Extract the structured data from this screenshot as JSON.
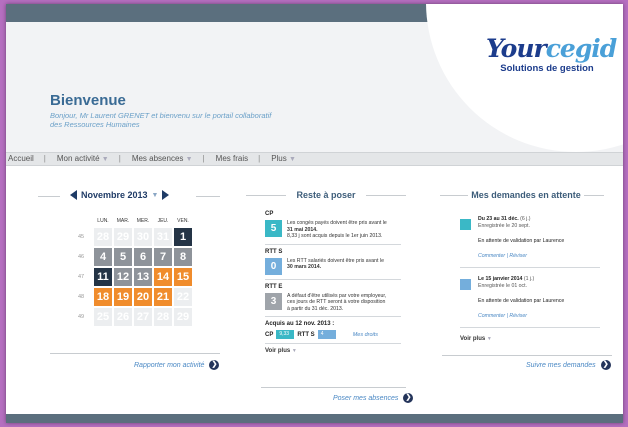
{
  "topbar": {
    "icons": [
      "help-icon",
      "calendar-icon",
      "home-icon",
      "power-icon"
    ]
  },
  "logo": {
    "brand_a": "Your",
    "brand_b": "cegid",
    "tagline": "Solutions de gestion"
  },
  "welcome": {
    "title": "Bienvenue",
    "subtitle_line1": "Bonjour, Mr Laurent GRENET et bienvenu sur le portail collaboratif",
    "subtitle_line2": "des Ressources Humaines"
  },
  "nav": {
    "items": [
      {
        "label": "Accueil"
      },
      {
        "label": "Mon activité"
      },
      {
        "label": "Mes absences"
      },
      {
        "label": "Mes frais"
      },
      {
        "label": "Plus"
      }
    ],
    "separator": "|",
    "caret": "▼"
  },
  "calendar": {
    "month": "Novembre 2013",
    "caret": "▼",
    "day_heads": [
      "LUN.",
      "MAR.",
      "MER.",
      "JEU.",
      "VEN."
    ],
    "weeks": [
      {
        "num": "45",
        "days": [
          {
            "n": "28",
            "s": "light"
          },
          {
            "n": "29",
            "s": "light"
          },
          {
            "n": "30",
            "s": "light"
          },
          {
            "n": "31",
            "s": "light"
          },
          {
            "n": "1",
            "s": "dark"
          }
        ]
      },
      {
        "num": "46",
        "days": [
          {
            "n": "4",
            "s": "grey"
          },
          {
            "n": "5",
            "s": "grey"
          },
          {
            "n": "6",
            "s": "grey"
          },
          {
            "n": "7",
            "s": "grey"
          },
          {
            "n": "8",
            "s": "grey"
          }
        ]
      },
      {
        "num": "47",
        "days": [
          {
            "n": "11",
            "s": "dark"
          },
          {
            "n": "12",
            "s": "grey"
          },
          {
            "n": "13",
            "s": "grey"
          },
          {
            "n": "14",
            "s": "orange"
          },
          {
            "n": "15",
            "s": "orange"
          }
        ]
      },
      {
        "num": "48",
        "days": [
          {
            "n": "18",
            "s": "orange"
          },
          {
            "n": "19",
            "s": "orange"
          },
          {
            "n": "20",
            "s": "orange"
          },
          {
            "n": "21",
            "s": "orange"
          },
          {
            "n": "22",
            "s": "light"
          }
        ]
      },
      {
        "num": "49",
        "days": [
          {
            "n": "25",
            "s": "light"
          },
          {
            "n": "26",
            "s": "light"
          },
          {
            "n": "27",
            "s": "light"
          },
          {
            "n": "28",
            "s": "light"
          },
          {
            "n": "29",
            "s": "light"
          }
        ]
      }
    ],
    "link": "Rapporter mon activité"
  },
  "reste": {
    "title": "Reste à poser",
    "blocks": [
      {
        "title": "CP",
        "value": "5",
        "color": "#3ab8c6",
        "line1": "Les congés payés doivent être pris avant le",
        "line2": "31 mai 2014.",
        "line3": "8,33 j sont acquis depuis le 1er juin 2013."
      },
      {
        "title": "RTT S",
        "value": "0",
        "color": "#74aedc",
        "line1": "Les RTT salariés doivent être pris avant le",
        "line2": "30 mars 2014.",
        "line3": ""
      },
      {
        "title": "RTT E",
        "value": "3",
        "color": "#9fa4aa",
        "line1": "A défaut d'être utilisés par votre employeur,",
        "line2": "ces jours de RTT seront à votre disposition",
        "line3": "à partir du 31 déc. 2013."
      }
    ],
    "acquis_title": "Acquis au 12 nov. 2013 :",
    "acquis_cp_label": "CP",
    "acquis_cp_value": "9,33",
    "acquis_rtt_label": "RTT S",
    "acquis_rtt_value": "4",
    "mes_droits": "Mes droits",
    "voir_plus": "Voir plus",
    "link": "Poser mes absences"
  },
  "demandes": {
    "title": "Mes demandes en attente",
    "items": [
      {
        "period": "Du 23 au 31 déc.",
        "days": "(6 j.)",
        "registered": "Enregistrée le 20 sept.",
        "status": "En attente de validation par Laurence",
        "color": "#3ab8c6"
      },
      {
        "period": "Le 15 janvier 2014",
        "days": "(1 j.)",
        "registered": "Enregistrée le 01 oct.",
        "status": "En attente de validation par Laurence",
        "color": "#74aedc"
      }
    ],
    "commenter": "Commenter",
    "reviser": "Réviser",
    "link_sep": "|",
    "voir_plus": "Voir plus",
    "link": "Suivre mes demandes"
  },
  "footer": {
    "text": ""
  }
}
